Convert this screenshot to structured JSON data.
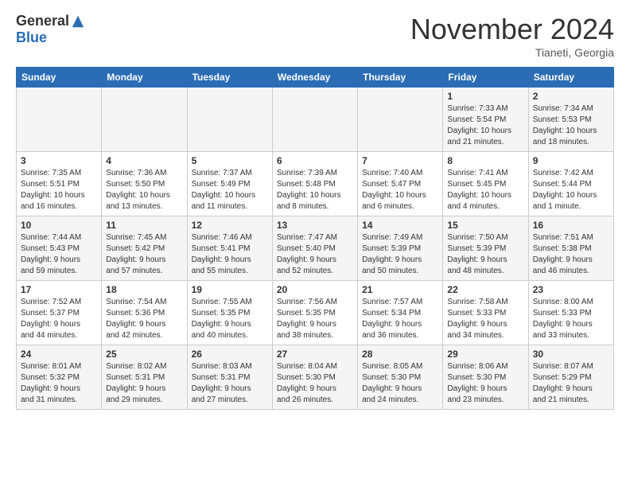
{
  "logo": {
    "general": "General",
    "blue": "Blue"
  },
  "header": {
    "month": "November 2024",
    "location": "Tianeti, Georgia"
  },
  "weekdays": [
    "Sunday",
    "Monday",
    "Tuesday",
    "Wednesday",
    "Thursday",
    "Friday",
    "Saturday"
  ],
  "weeks": [
    [
      {
        "day": "",
        "info": ""
      },
      {
        "day": "",
        "info": ""
      },
      {
        "day": "",
        "info": ""
      },
      {
        "day": "",
        "info": ""
      },
      {
        "day": "",
        "info": ""
      },
      {
        "day": "1",
        "info": "Sunrise: 7:33 AM\nSunset: 5:54 PM\nDaylight: 10 hours\nand 21 minutes."
      },
      {
        "day": "2",
        "info": "Sunrise: 7:34 AM\nSunset: 5:53 PM\nDaylight: 10 hours\nand 18 minutes."
      }
    ],
    [
      {
        "day": "3",
        "info": "Sunrise: 7:35 AM\nSunset: 5:51 PM\nDaylight: 10 hours\nand 16 minutes."
      },
      {
        "day": "4",
        "info": "Sunrise: 7:36 AM\nSunset: 5:50 PM\nDaylight: 10 hours\nand 13 minutes."
      },
      {
        "day": "5",
        "info": "Sunrise: 7:37 AM\nSunset: 5:49 PM\nDaylight: 10 hours\nand 11 minutes."
      },
      {
        "day": "6",
        "info": "Sunrise: 7:39 AM\nSunset: 5:48 PM\nDaylight: 10 hours\nand 8 minutes."
      },
      {
        "day": "7",
        "info": "Sunrise: 7:40 AM\nSunset: 5:47 PM\nDaylight: 10 hours\nand 6 minutes."
      },
      {
        "day": "8",
        "info": "Sunrise: 7:41 AM\nSunset: 5:45 PM\nDaylight: 10 hours\nand 4 minutes."
      },
      {
        "day": "9",
        "info": "Sunrise: 7:42 AM\nSunset: 5:44 PM\nDaylight: 10 hours\nand 1 minute."
      }
    ],
    [
      {
        "day": "10",
        "info": "Sunrise: 7:44 AM\nSunset: 5:43 PM\nDaylight: 9 hours\nand 59 minutes."
      },
      {
        "day": "11",
        "info": "Sunrise: 7:45 AM\nSunset: 5:42 PM\nDaylight: 9 hours\nand 57 minutes."
      },
      {
        "day": "12",
        "info": "Sunrise: 7:46 AM\nSunset: 5:41 PM\nDaylight: 9 hours\nand 55 minutes."
      },
      {
        "day": "13",
        "info": "Sunrise: 7:47 AM\nSunset: 5:40 PM\nDaylight: 9 hours\nand 52 minutes."
      },
      {
        "day": "14",
        "info": "Sunrise: 7:49 AM\nSunset: 5:39 PM\nDaylight: 9 hours\nand 50 minutes."
      },
      {
        "day": "15",
        "info": "Sunrise: 7:50 AM\nSunset: 5:39 PM\nDaylight: 9 hours\nand 48 minutes."
      },
      {
        "day": "16",
        "info": "Sunrise: 7:51 AM\nSunset: 5:38 PM\nDaylight: 9 hours\nand 46 minutes."
      }
    ],
    [
      {
        "day": "17",
        "info": "Sunrise: 7:52 AM\nSunset: 5:37 PM\nDaylight: 9 hours\nand 44 minutes."
      },
      {
        "day": "18",
        "info": "Sunrise: 7:54 AM\nSunset: 5:36 PM\nDaylight: 9 hours\nand 42 minutes."
      },
      {
        "day": "19",
        "info": "Sunrise: 7:55 AM\nSunset: 5:35 PM\nDaylight: 9 hours\nand 40 minutes."
      },
      {
        "day": "20",
        "info": "Sunrise: 7:56 AM\nSunset: 5:35 PM\nDaylight: 9 hours\nand 38 minutes."
      },
      {
        "day": "21",
        "info": "Sunrise: 7:57 AM\nSunset: 5:34 PM\nDaylight: 9 hours\nand 36 minutes."
      },
      {
        "day": "22",
        "info": "Sunrise: 7:58 AM\nSunset: 5:33 PM\nDaylight: 9 hours\nand 34 minutes."
      },
      {
        "day": "23",
        "info": "Sunrise: 8:00 AM\nSunset: 5:33 PM\nDaylight: 9 hours\nand 33 minutes."
      }
    ],
    [
      {
        "day": "24",
        "info": "Sunrise: 8:01 AM\nSunset: 5:32 PM\nDaylight: 9 hours\nand 31 minutes."
      },
      {
        "day": "25",
        "info": "Sunrise: 8:02 AM\nSunset: 5:31 PM\nDaylight: 9 hours\nand 29 minutes."
      },
      {
        "day": "26",
        "info": "Sunrise: 8:03 AM\nSunset: 5:31 PM\nDaylight: 9 hours\nand 27 minutes."
      },
      {
        "day": "27",
        "info": "Sunrise: 8:04 AM\nSunset: 5:30 PM\nDaylight: 9 hours\nand 26 minutes."
      },
      {
        "day": "28",
        "info": "Sunrise: 8:05 AM\nSunset: 5:30 PM\nDaylight: 9 hours\nand 24 minutes."
      },
      {
        "day": "29",
        "info": "Sunrise: 8:06 AM\nSunset: 5:30 PM\nDaylight: 9 hours\nand 23 minutes."
      },
      {
        "day": "30",
        "info": "Sunrise: 8:07 AM\nSunset: 5:29 PM\nDaylight: 9 hours\nand 21 minutes."
      }
    ]
  ]
}
